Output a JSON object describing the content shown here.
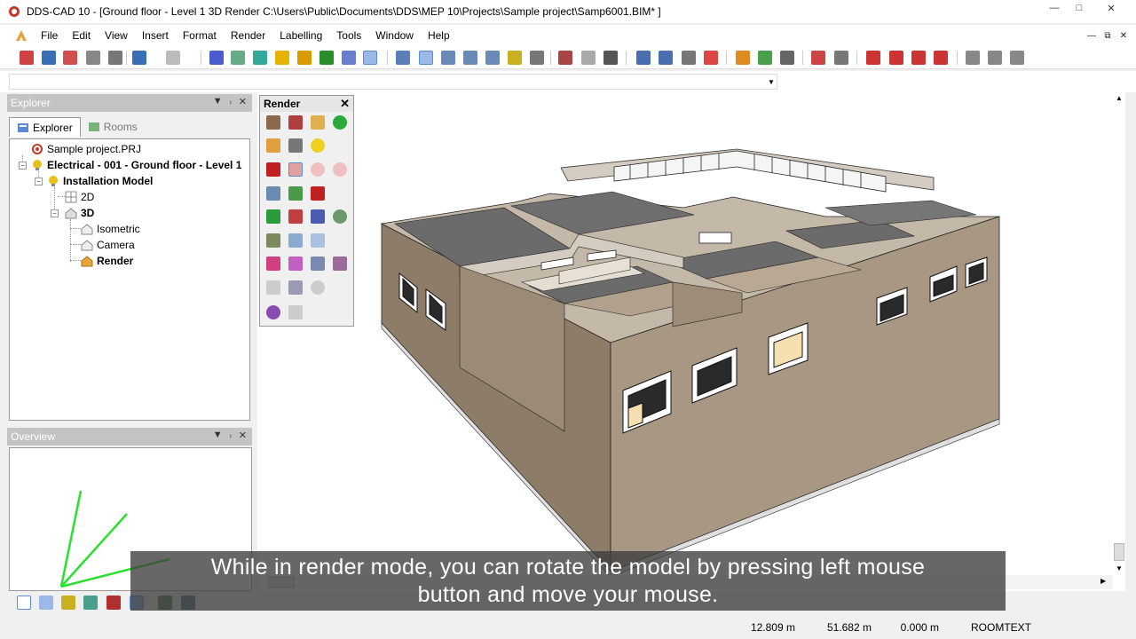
{
  "window": {
    "title": "DDS-CAD 10 - [Ground floor - Level 1  3D  Render  C:\\Users\\Public\\Documents\\DDS\\MEP 10\\Projects\\Sample project\\Samp6001.BIM* ]",
    "minimize_glyph": "—",
    "maximize_glyph": "□",
    "close_glyph": "✕"
  },
  "menu": {
    "items": [
      "File",
      "Edit",
      "View",
      "Insert",
      "Format",
      "Render",
      "Labelling",
      "Tools",
      "Window",
      "Help"
    ],
    "mdi_minimize_glyph": "—",
    "mdi_restore_glyph": "⧉",
    "mdi_close_glyph": "✕"
  },
  "cmdbar": {
    "value": "",
    "dropdown_glyph": "▼"
  },
  "explorer": {
    "title": "Explorer",
    "pin_glyph": "▼",
    "dock_glyph": "⨾",
    "close_glyph": "✕",
    "tabs": [
      {
        "label": "Explorer"
      },
      {
        "label": "Rooms"
      }
    ],
    "tree": [
      {
        "label": "Sample project.PRJ"
      },
      {
        "label": "Electrical - 001 - Ground floor - Level 1"
      },
      {
        "label": "Installation Model"
      },
      {
        "label": "2D"
      },
      {
        "label": "3D"
      },
      {
        "label": "Isometric"
      },
      {
        "label": "Camera"
      },
      {
        "label": "Render"
      }
    ]
  },
  "overview": {
    "title": "Overview"
  },
  "render_panel": {
    "title": "Render",
    "close_glyph": "✕"
  },
  "caption": {
    "line1": "While in render mode, you can rotate the model by pressing left mouse",
    "line2": "button and move your mouse."
  },
  "status": {
    "x": "12.809 m",
    "y": "51.682 m",
    "z": "0.000 m",
    "mode": "ROOMTEXT"
  },
  "colors": {
    "wall": "#a89783",
    "wall_dark": "#8c7c68",
    "wall_top": "#d4ccc0",
    "floor": "#6b6b6b",
    "axis_green": "#29e02e",
    "panel_header": "#c4c4c4"
  }
}
